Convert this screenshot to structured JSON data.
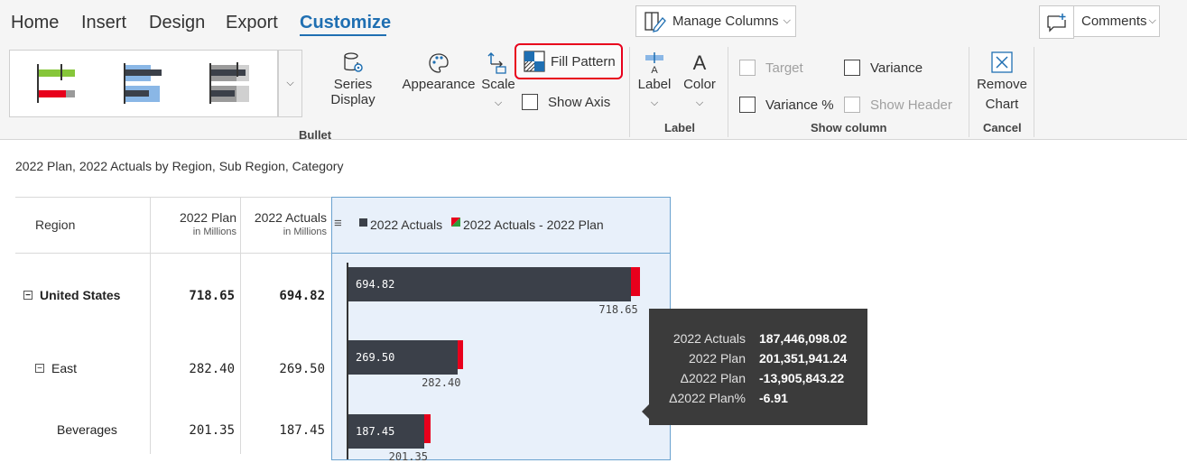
{
  "tabs": [
    {
      "label": "Home"
    },
    {
      "label": "Insert"
    },
    {
      "label": "Design"
    },
    {
      "label": "Export"
    },
    {
      "label": "Customize",
      "active": true
    }
  ],
  "top_buttons": {
    "manage_columns": "Manage Columns",
    "comments": "Comments"
  },
  "ribbon": {
    "bullet_group_label": "Bullet",
    "series_display": "Series Display",
    "appearance": "Appearance",
    "scale": "Scale",
    "fill_pattern": "Fill Pattern",
    "show_axis": "Show Axis",
    "label_btn": "Label",
    "color_btn": "Color",
    "label_group_label": "Label",
    "target": "Target",
    "variance": "Variance",
    "variance_pct": "Variance %",
    "show_header": "Show Header",
    "show_column_group_label": "Show column",
    "remove_chart_line1": "Remove",
    "remove_chart_line2": "Chart",
    "cancel_group_label": "Cancel"
  },
  "report": {
    "subtitle": "2022 Plan, 2022 Actuals by Region, Sub Region, Category",
    "columns": {
      "region": "Region",
      "plan": "2022 Plan",
      "plan_unit": "in Millions",
      "actuals": "2022 Actuals",
      "actuals_unit": "in Millions"
    },
    "legend": {
      "actuals": "2022 Actuals",
      "variance": "2022 Actuals - 2022 Plan"
    },
    "rows": [
      {
        "label": "United States",
        "plan": "718.65",
        "actual": "694.82",
        "level": 0
      },
      {
        "label": "East",
        "plan": "282.40",
        "actual": "269.50",
        "level": 1
      },
      {
        "label": "Beverages",
        "plan": "201.35",
        "actual": "187.45",
        "level": 2
      }
    ]
  },
  "chart_data": {
    "type": "bar",
    "categories": [
      "United States",
      "East",
      "Beverages"
    ],
    "series": [
      {
        "name": "2022 Actuals",
        "values": [
          694.82,
          269.5,
          187.45
        ]
      },
      {
        "name": "2022 Plan",
        "values": [
          718.65,
          282.4,
          201.35
        ]
      }
    ],
    "variance_series": "2022 Actuals - 2022 Plan",
    "colors": {
      "actuals": "#3b4049",
      "variance": "#e8001c"
    }
  },
  "tooltip": [
    {
      "key": "2022 Actuals",
      "value": "187,446,098.02"
    },
    {
      "key": "2022 Plan",
      "value": "201,351,941.24"
    },
    {
      "key": "Δ2022 Plan",
      "value": "-13,905,843.22"
    },
    {
      "key": "Δ2022 Plan%",
      "value": "-6.91"
    }
  ],
  "colors": {
    "accent": "#1f6fb2",
    "highlight": "#e8001c"
  }
}
